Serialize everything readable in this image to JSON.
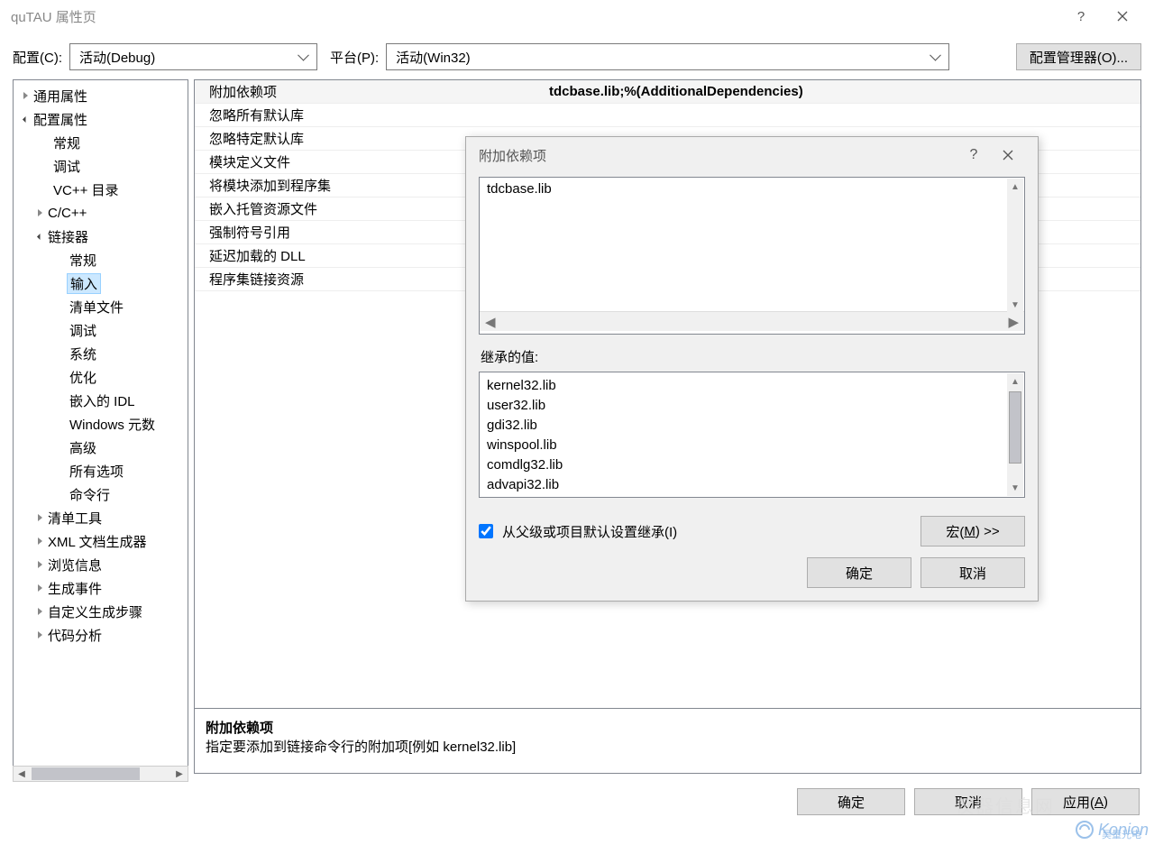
{
  "window": {
    "title": "quTAU 属性页"
  },
  "toolbar": {
    "config_label": "配置(C):",
    "config_value": "活动(Debug)",
    "platform_label": "平台(P):",
    "platform_value": "活动(Win32)",
    "config_manager": "配置管理器(O)..."
  },
  "tree": {
    "n01": "通用属性",
    "n02": "配置属性",
    "n03": "常规",
    "n04": "调试",
    "n05": "VC++ 目录",
    "n06": "C/C++",
    "n07": "链接器",
    "n08": "常规",
    "n09": "输入",
    "n10": "清单文件",
    "n11": "调试",
    "n12": "系统",
    "n13": "优化",
    "n14": "嵌入的 IDL",
    "n15": "Windows 元数",
    "n16": "高级",
    "n17": "所有选项",
    "n18": "命令行",
    "n19": "清单工具",
    "n20": "XML 文档生成器",
    "n21": "浏览信息",
    "n22": "生成事件",
    "n23": "自定义生成步骤",
    "n24": "代码分析"
  },
  "props": {
    "r1n": "附加依赖项",
    "r1v": "tdcbase.lib;%(AdditionalDependencies)",
    "r2n": "忽略所有默认库",
    "r3n": "忽略特定默认库",
    "r4n": "模块定义文件",
    "r5n": "将模块添加到程序集",
    "r6n": "嵌入托管资源文件",
    "r7n": "强制符号引用",
    "r8n": "延迟加载的 DLL",
    "r9n": "程序集链接资源"
  },
  "desc": {
    "title": "附加依赖项",
    "text": "指定要添加到链接命令行的附加项[例如 kernel32.lib]"
  },
  "dialog": {
    "title": "附加依赖项",
    "edit_value": "tdcbase.lib",
    "inherit_label": "继承的值:",
    "inherit_items": [
      "kernel32.lib",
      "user32.lib",
      "gdi32.lib",
      "winspool.lib",
      "comdlg32.lib",
      "advapi32.lib"
    ],
    "checkbox_label": "从父级或项目默认设置继承(I)",
    "macro_btn_pre": "宏(",
    "macro_btn_u": "M",
    "macro_btn_post": ") >>",
    "ok": "确定",
    "cancel": "取消"
  },
  "buttons": {
    "ok": "确定",
    "cancel": "取消",
    "apply_pre": "应用(",
    "apply_u": "A",
    "apply_post": ")"
  },
  "watermark": {
    "text": "Konion",
    "sub": "昊量光电"
  },
  "watermark2": "仪器信息网"
}
